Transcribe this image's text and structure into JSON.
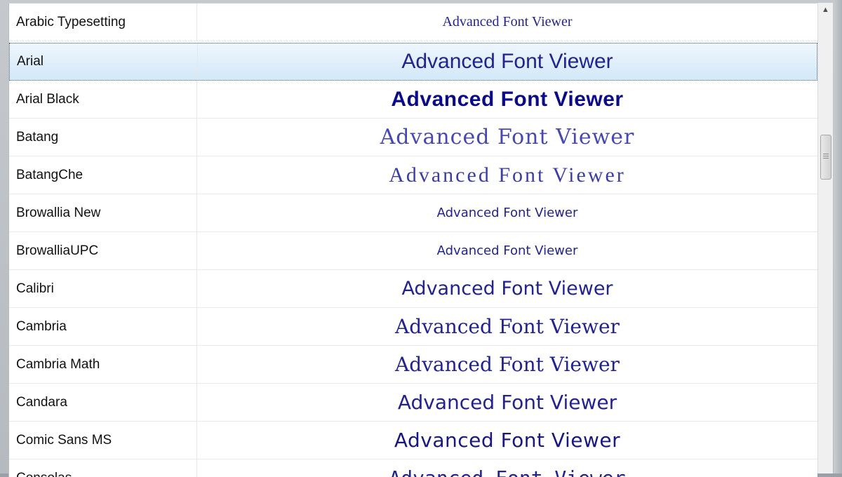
{
  "sample_text": "Advanced Font Viewer",
  "selected_index": 1,
  "fonts": [
    {
      "name": "Arabic Typesetting",
      "preview": "Advanced Font Viewer"
    },
    {
      "name": "Arial",
      "preview": "Advanced Font Viewer"
    },
    {
      "name": "Arial Black",
      "preview": "Advanced Font Viewer"
    },
    {
      "name": "Batang",
      "preview": "Advanced Font Viewer"
    },
    {
      "name": "BatangChe",
      "preview": "Advanced Font Viewer"
    },
    {
      "name": "Browallia New",
      "preview": "Advanced Font Viewer"
    },
    {
      "name": "BrowalliaUPC",
      "preview": "Advanced Font Viewer"
    },
    {
      "name": "Calibri",
      "preview": "Advanced Font Viewer"
    },
    {
      "name": "Cambria",
      "preview": "Advanced Font Viewer"
    },
    {
      "name": "Cambria Math",
      "preview": "Advanced Font Viewer"
    },
    {
      "name": "Candara",
      "preview": "Advanced Font Viewer"
    },
    {
      "name": "Comic Sans MS",
      "preview": "Advanced Font Viewer"
    },
    {
      "name": "Consolas",
      "preview": "Advanced Font Viewer"
    }
  ],
  "colors": {
    "preview_text": "#23238f",
    "selection_bg": "#d3e8f8"
  },
  "scrollbar": {
    "up_icon": "scroll-up-arrow-icon"
  }
}
